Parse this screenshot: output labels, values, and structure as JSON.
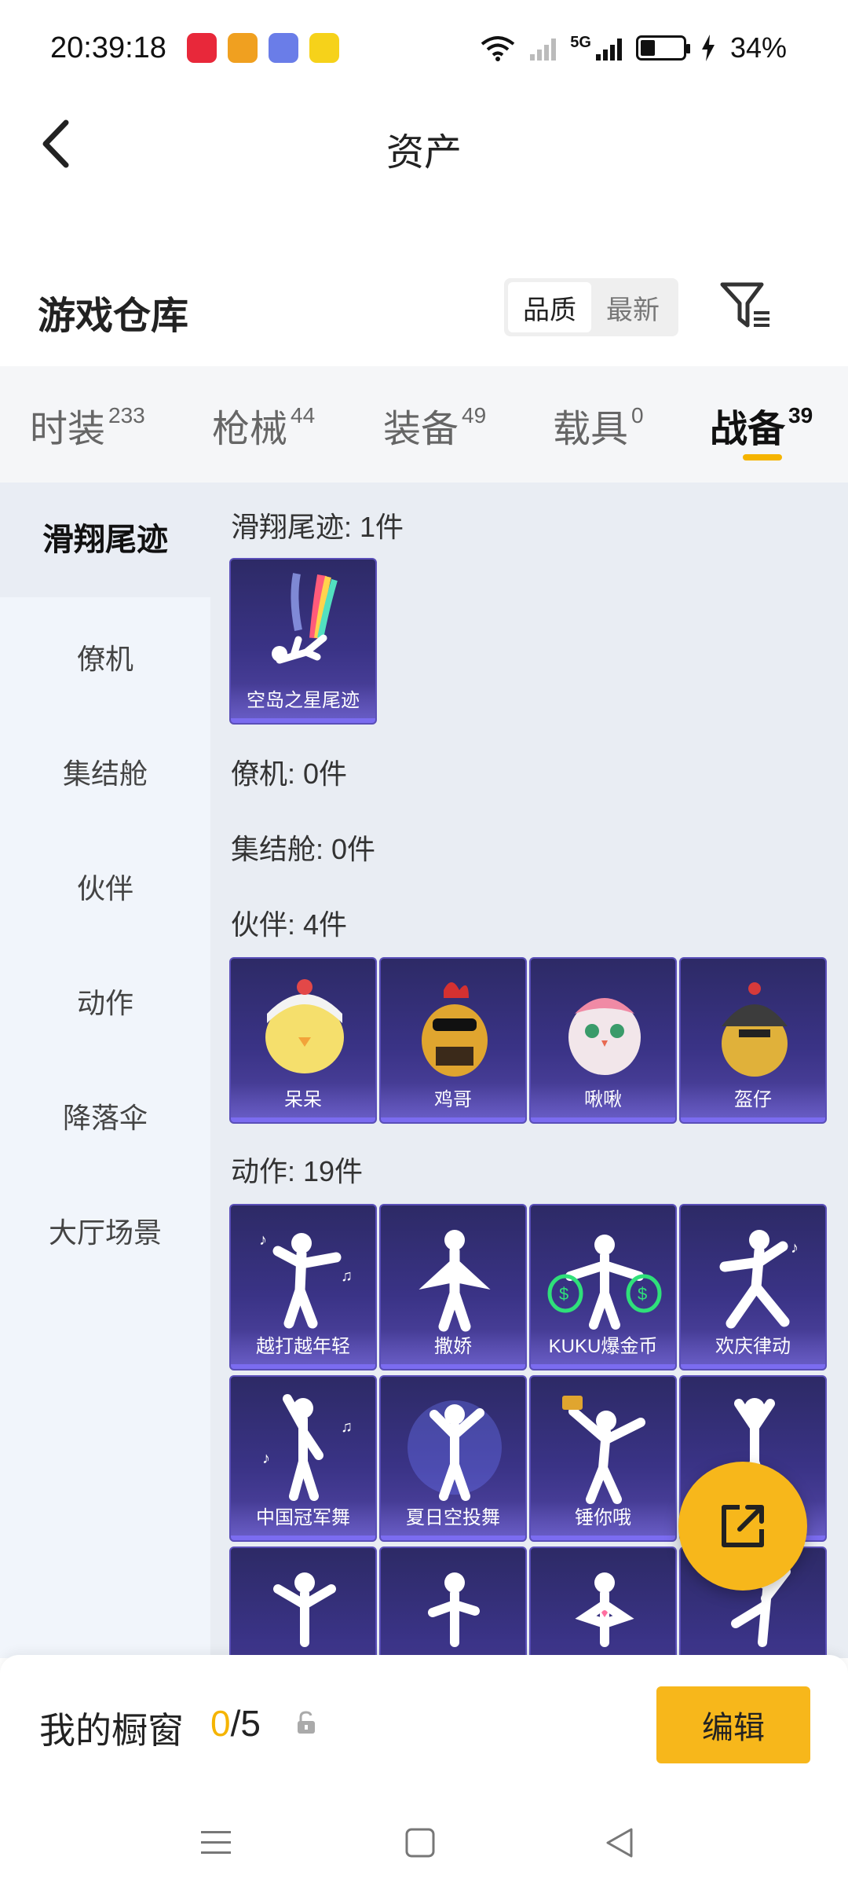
{
  "status_bar": {
    "time": "20:39:18",
    "battery_percent": "34%",
    "network": "5G"
  },
  "header": {
    "title": "资产",
    "back_icon": "chevron-left-icon"
  },
  "warehouse": {
    "title": "游戏仓库",
    "sort_options": [
      "品质",
      "最新"
    ],
    "sort_selected": "品质",
    "filter_icon": "filter-icon"
  },
  "tabs": [
    {
      "label": "时装",
      "count": "233"
    },
    {
      "label": "枪械",
      "count": "44"
    },
    {
      "label": "装备",
      "count": "49"
    },
    {
      "label": "载具",
      "count": "0"
    },
    {
      "label": "战备",
      "count": "39"
    }
  ],
  "active_tab": "战备",
  "sidebar": {
    "items": [
      "滑翔尾迹",
      "僚机",
      "集结舱",
      "伙伴",
      "动作",
      "降落伞",
      "大厅场景"
    ],
    "active": "滑翔尾迹"
  },
  "sections": {
    "trail": {
      "title": "滑翔尾迹: 1件",
      "items": [
        "空岛之星尾迹"
      ]
    },
    "wingman": {
      "title": "僚机: 0件"
    },
    "capsule": {
      "title": "集结舱: 0件"
    },
    "partner": {
      "title": "伙伴: 4件",
      "items": [
        "呆呆",
        "鸡哥",
        "啾啾",
        "盔仔"
      ]
    },
    "emote": {
      "title": "动作: 19件",
      "items": [
        "越打越年轻",
        "撒娇",
        "KUKU爆金币",
        "欢庆律动",
        "中国冠军舞",
        "夏日空投舞",
        "锤你哦",
        "",
        "",
        "",
        "",
        ""
      ]
    }
  },
  "bottom_bar": {
    "label": "我的橱窗",
    "current": "0",
    "total": "/5",
    "edit_label": "编辑"
  },
  "colors": {
    "accent": "#f5b400",
    "card_bg": "#3a3386",
    "sidebar_bg": "#f1f5fb"
  }
}
